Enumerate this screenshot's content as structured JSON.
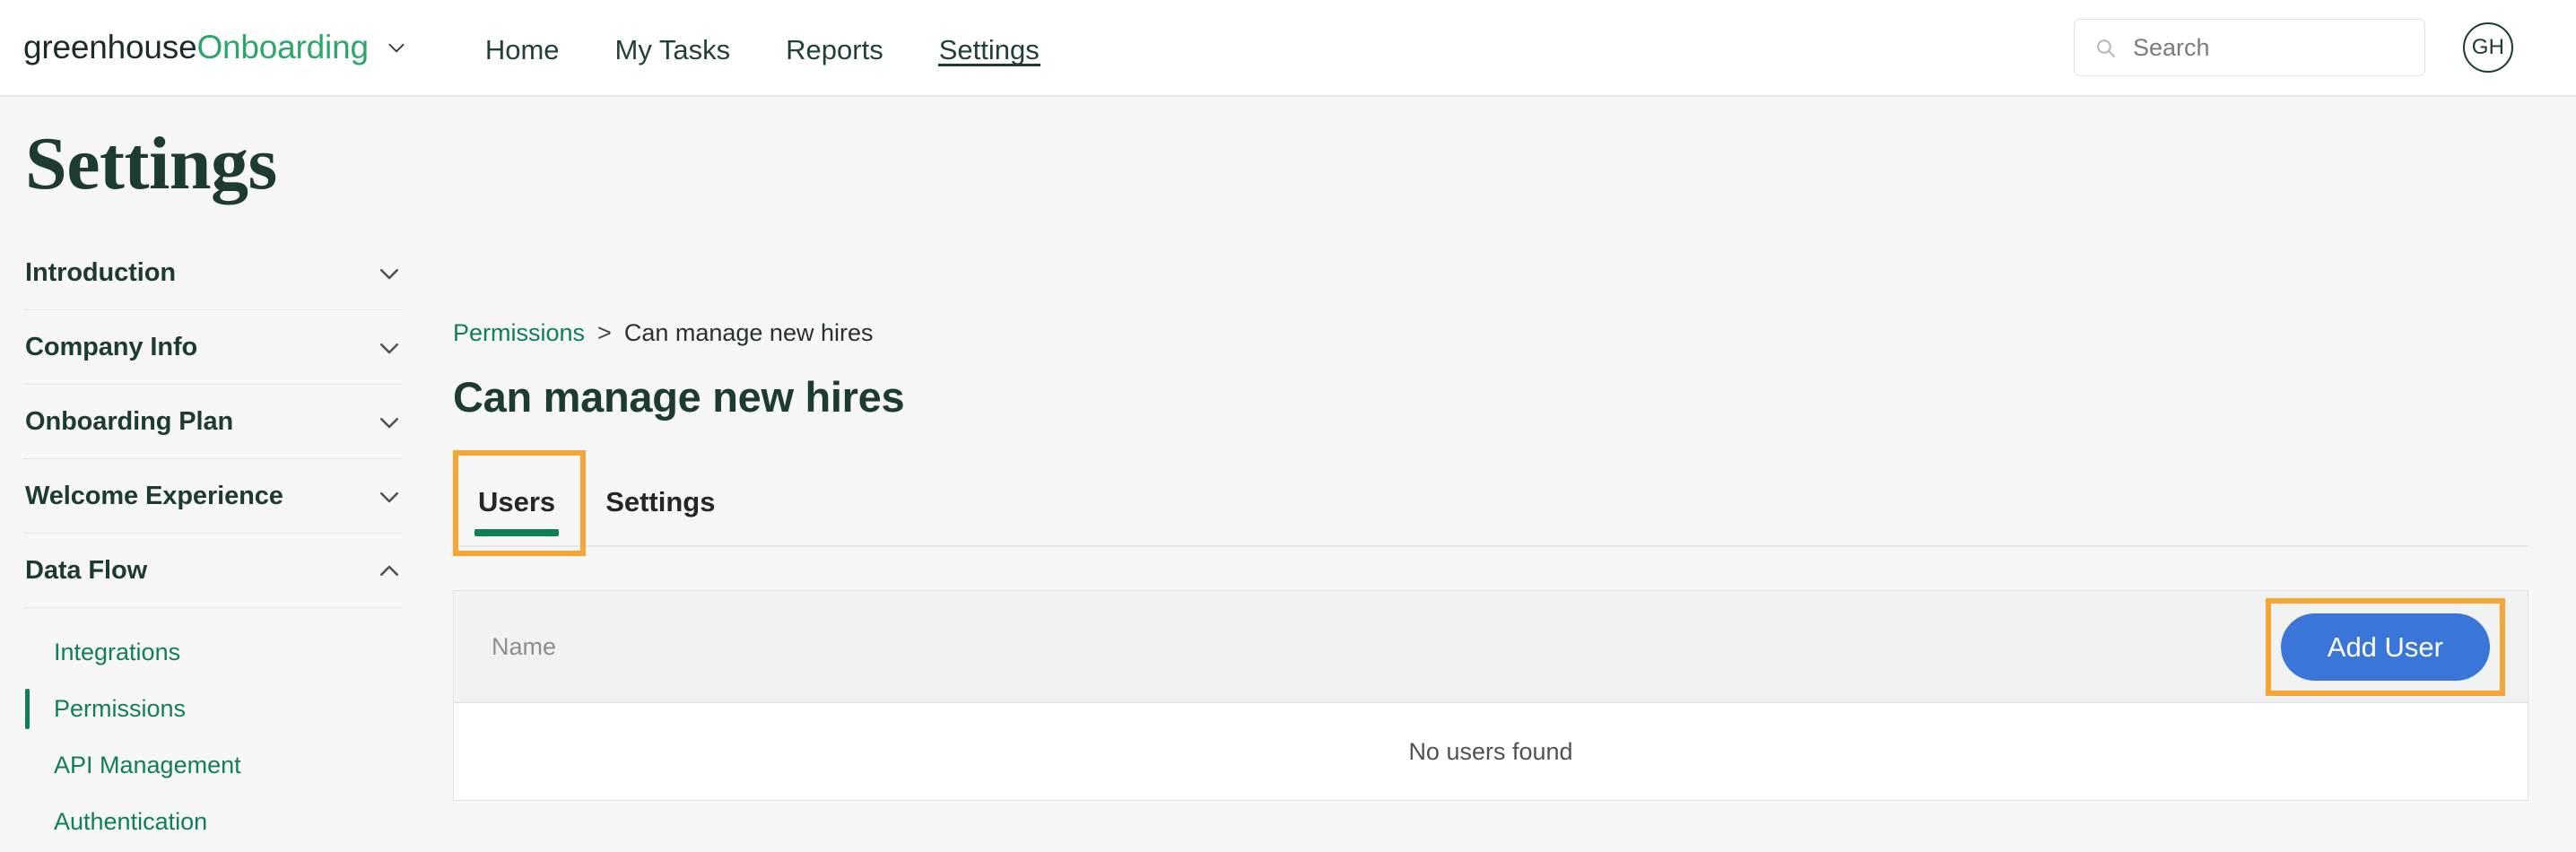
{
  "header": {
    "brand": {
      "company": "greenhouse",
      "product": "Onboarding",
      "chevron_icon": "chevron-down-icon"
    },
    "nav_items": [
      {
        "label": "Home",
        "active": false
      },
      {
        "label": "My Tasks",
        "active": false
      },
      {
        "label": "Reports",
        "active": false
      },
      {
        "label": "Settings",
        "active": true
      }
    ],
    "search": {
      "placeholder": "Search",
      "value": "",
      "icon": "search-icon"
    },
    "avatar": {
      "initials": "GH"
    }
  },
  "sidebar": {
    "title": "Settings",
    "groups": [
      {
        "label": "Introduction",
        "expanded": false,
        "chevron_icon": "chevron-down-icon"
      },
      {
        "label": "Company Info",
        "expanded": false,
        "chevron_icon": "chevron-down-icon"
      },
      {
        "label": "Onboarding Plan",
        "expanded": false,
        "chevron_icon": "chevron-down-icon"
      },
      {
        "label": "Welcome Experience",
        "expanded": false,
        "chevron_icon": "chevron-down-icon"
      },
      {
        "label": "Data Flow",
        "expanded": true,
        "chevron_icon": "chevron-up-icon"
      }
    ],
    "sub_items": [
      {
        "label": "Integrations",
        "active": false
      },
      {
        "label": "Permissions",
        "active": true
      },
      {
        "label": "API Management",
        "active": false
      },
      {
        "label": "Authentication",
        "active": false
      }
    ]
  },
  "main": {
    "breadcrumb": {
      "parent": "Permissions",
      "separator": ">",
      "current": "Can manage new hires"
    },
    "page_title": "Can manage new hires",
    "tabs": [
      {
        "label": "Users",
        "active": true,
        "highlighted": true
      },
      {
        "label": "Settings",
        "active": false,
        "highlighted": false
      }
    ],
    "table": {
      "columns": [
        "Name"
      ],
      "rows": [],
      "empty_message": "No users found",
      "add_user_label": "Add User"
    }
  },
  "colors": {
    "brand_green": "#2fa56e",
    "dark_green": "#1d3a33",
    "link_green": "#0f8055",
    "tab_indicator": "#0f7f56",
    "primary_button": "#3a76d8",
    "highlight_orange": "#f7a534",
    "page_background": "#f7f7f7",
    "table_header_background": "#f1f2f2"
  }
}
